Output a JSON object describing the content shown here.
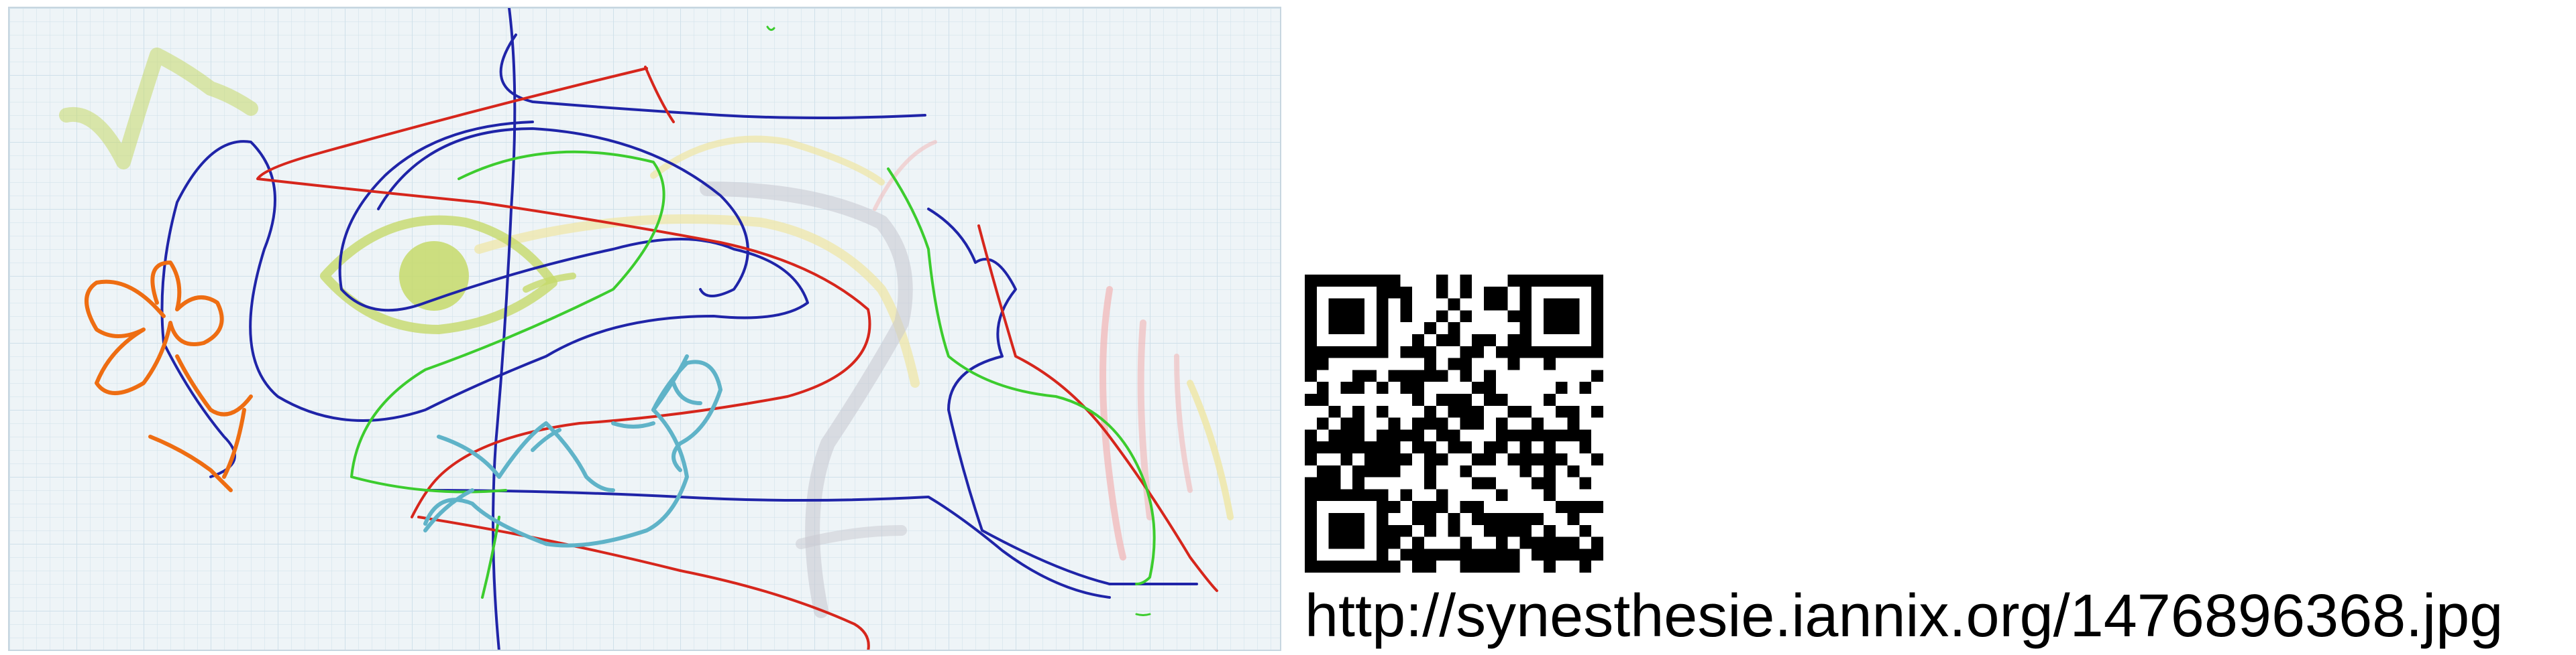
{
  "drawing": {
    "background_color": "#eef4f7",
    "grid_color": "#cfe0ea",
    "stroke_colors": {
      "red": "#d6261c",
      "dark_blue": "#1f24a8",
      "green": "#3ccc2e",
      "orange": "#ee6d12",
      "teal": "#5fb3c8",
      "yellow_green": "#c6d96a",
      "light_yellow": "#efe6a3",
      "pink": "#f2b3b3",
      "gray": "#c7c7cf"
    }
  },
  "qr_code": {
    "icon": "qr-code-icon"
  },
  "url_text": "http://synesthesie.iannix.org/1476896368.jpg"
}
